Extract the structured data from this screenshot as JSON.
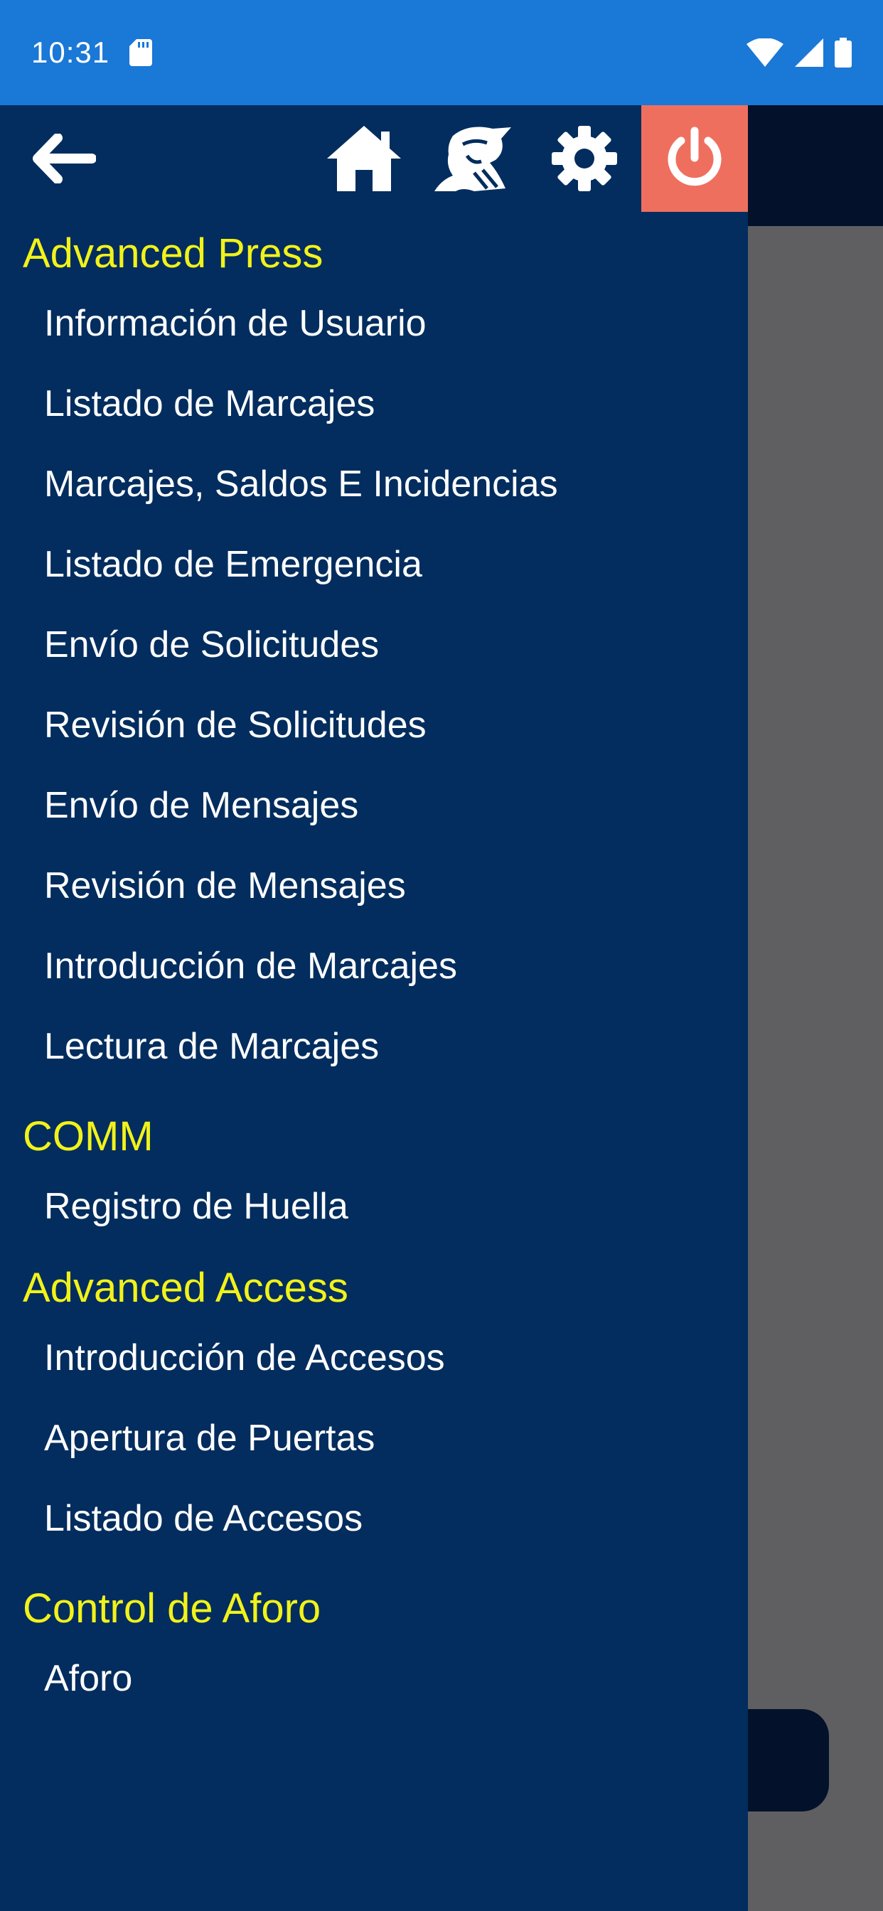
{
  "status_bar": {
    "time": "10:31",
    "icons": [
      "sd-card-icon",
      "wifi-icon",
      "cell-signal-icon",
      "battery-icon"
    ]
  },
  "toolbar": {
    "icons": [
      "back-arrow-icon",
      "home-icon",
      "company-logo-icon",
      "gear-icon",
      "power-icon"
    ],
    "accent_color": "#ef6f5f"
  },
  "colors": {
    "status_bar": "#1a78d6",
    "drawer_bg": "#022d5e",
    "section_title": "#f2f21a",
    "item_text": "#ffffff"
  },
  "sections": [
    {
      "title": "Advanced Press",
      "items": [
        "Información de Usuario",
        "Listado de Marcajes",
        "Marcajes, Saldos E Incidencias",
        "Listado de Emergencia",
        "Envío de Solicitudes",
        "Revisión de Solicitudes",
        "Envío de Mensajes",
        "Revisión de Mensajes",
        "Introducción de Marcajes",
        "Lectura de Marcajes"
      ]
    },
    {
      "title": "COMM",
      "items": [
        "Registro de Huella"
      ]
    },
    {
      "title": "Advanced Access",
      "items": [
        "Introducción de Accesos",
        "Apertura de Puertas",
        "Listado de Accesos"
      ]
    },
    {
      "title": "Control de Aforo",
      "items": [
        "Aforo"
      ]
    }
  ]
}
